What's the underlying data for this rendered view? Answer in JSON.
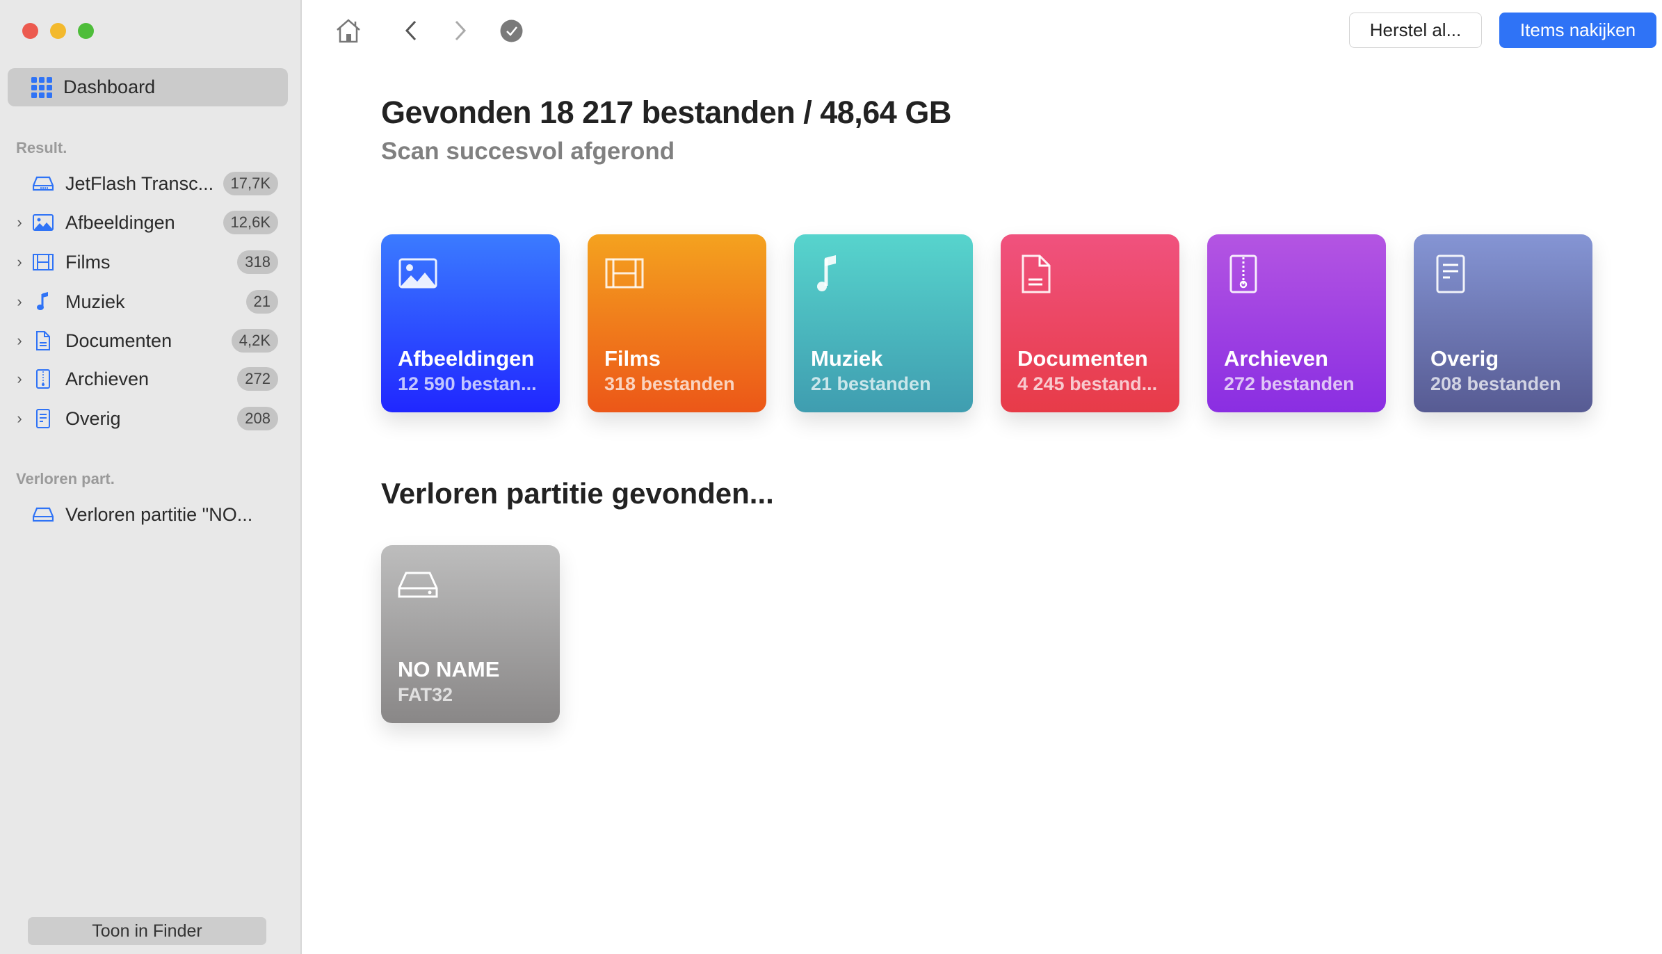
{
  "sidebar": {
    "dashboard": "Dashboard",
    "results_header": "Result.",
    "items": [
      {
        "label": "JetFlash Transc...",
        "count": "17,7K",
        "icon": "drive-icon",
        "expandable": false
      },
      {
        "label": "Afbeeldingen",
        "count": "12,6K",
        "icon": "image-icon",
        "expandable": true
      },
      {
        "label": "Films",
        "count": "318",
        "icon": "film-icon",
        "expandable": true
      },
      {
        "label": "Muziek",
        "count": "21",
        "icon": "music-icon",
        "expandable": true
      },
      {
        "label": "Documenten",
        "count": "4,2K",
        "icon": "document-icon",
        "expandable": true
      },
      {
        "label": "Archieven",
        "count": "272",
        "icon": "archive-icon",
        "expandable": true
      },
      {
        "label": "Overig",
        "count": "208",
        "icon": "other-icon",
        "expandable": true
      }
    ],
    "lost_header": "Verloren part.",
    "lost_items": [
      {
        "label": "Verloren partitie \"NO...",
        "icon": "drive-icon"
      }
    ],
    "finder_button": "Toon in Finder"
  },
  "toolbar": {
    "recover_all": "Herstel al...",
    "review_items": "Items nakijken"
  },
  "main": {
    "title": "Gevonden 18 217 bestanden / 48,64 GB",
    "subtitle": "Scan succesvol afgerond",
    "cards": [
      {
        "label": "Afbeeldingen",
        "sub": "12 590 bestan...",
        "colors": [
          "#3b7bff",
          "#2027ff"
        ]
      },
      {
        "label": "Films",
        "sub": "318 bestanden",
        "colors": [
          "#f4a21f",
          "#ec5718"
        ]
      },
      {
        "label": "Muziek",
        "sub": "21 bestanden",
        "colors": [
          "#57d4cd",
          "#3f9db0"
        ]
      },
      {
        "label": "Documenten",
        "sub": "4 245 bestand...",
        "colors": [
          "#f0527e",
          "#e73b48"
        ]
      },
      {
        "label": "Archieven",
        "sub": "272 bestanden",
        "colors": [
          "#b455e2",
          "#8a2ee2"
        ]
      },
      {
        "label": "Overig",
        "sub": "208 bestanden",
        "colors": [
          "#8595d4",
          "#575b93"
        ]
      }
    ],
    "lost_title": "Verloren partitie gevonden...",
    "partition": {
      "name": "NO NAME",
      "fs": "FAT32",
      "colors": [
        "#bdbdbd",
        "#898787"
      ]
    }
  },
  "accent": "#2f73f6"
}
